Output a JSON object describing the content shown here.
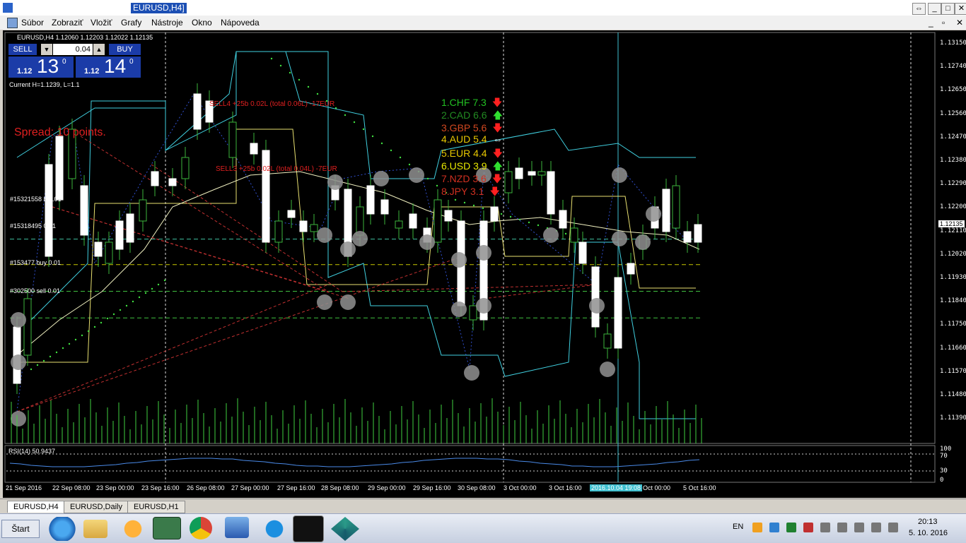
{
  "window": {
    "title": "EURUSD,H4]",
    "buttons": {
      "restore": "⇔",
      "minimize": "_",
      "maximize": "□",
      "close": "✕"
    }
  },
  "menu": [
    "Súbor",
    "Zobraziť",
    "Vložiť",
    "Grafy",
    "Nástroje",
    "Okno",
    "Nápoveda"
  ],
  "chart": {
    "header": "EURUSD,H4  1.12060 1.12203 1.12022 1.12135",
    "oneclick": {
      "sell": "SELL",
      "buy": "BUY",
      "lot": "0.04",
      "sell_small": "1.12",
      "sell_big": "13",
      "sell_sup": "0",
      "buy_small": "1.12",
      "buy_big": "14",
      "buy_sup": "0"
    },
    "current_hl": "Current H=1.1239, L=1.1",
    "spread": "Spread: 10 points.",
    "order_labels": [
      "#15321558 b 0.01",
      "#15318495 0.01",
      "#153477 buy 0.01",
      "#302500 sell 0.01"
    ],
    "trade_notes": [
      "SELL4  +25b  0.02L (total 0.06L)  -17EUR",
      "SELL3  +25b  0.02L (total 0.04L)  -7EUR"
    ],
    "current_price": "1.12135",
    "price_axis": [
      "1.13150",
      "1.12740",
      "1.12650",
      "1.12560",
      "1.12470",
      "1.12380",
      "1.12290",
      "1.12200",
      "1.12110",
      "1.12020",
      "1.11930",
      "1.11840",
      "1.11750",
      "1.11660",
      "1.11570",
      "1.11480",
      "1.11390"
    ],
    "time_axis": [
      "21 Sep 2016",
      "22 Sep 08:00",
      "23 Sep 00:00",
      "23 Sep 16:00",
      "26 Sep 08:00",
      "27 Sep 00:00",
      "27 Sep 16:00",
      "28 Sep 08:00",
      "29 Sep 00:00",
      "29 Sep 16:00",
      "30 Sep 08:00",
      "3 Oct 00:00",
      "3 Oct 16:00",
      "2016.10.04 19:08",
      "Oct 00:00",
      "5 Oct 16:00"
    ],
    "rsi_label": "RSI(14) 50.9437",
    "rsi_axis": [
      "100",
      "70",
      "30",
      "0"
    ]
  },
  "strength": [
    {
      "text": "1.CHF  7.3",
      "color": "#22c022",
      "arrow": "down"
    },
    {
      "text": "2.CAD  6.6",
      "color": "#228b22",
      "arrow": "up"
    },
    {
      "text": "3.GBP  5.6",
      "color": "#d24820",
      "arrow": "down"
    },
    {
      "text": "4.AUD  5.4",
      "color": "#e8c800",
      "arrow": "both"
    },
    {
      "text": "5.EUR  4.4",
      "color": "#e8c800",
      "arrow": "down"
    },
    {
      "text": "6.USD  3.9",
      "color": "#e8e800",
      "arrow": "up"
    },
    {
      "text": "7.NZD  3.6",
      "color": "#d03020",
      "arrow": "down"
    },
    {
      "text": "8.JPY  3.1",
      "color": "#d03020",
      "arrow": "down"
    }
  ],
  "tabs": [
    "EURUSD,H4",
    "EURUSD,Daily",
    "EURUSD,H1"
  ],
  "taskbar": {
    "start": "Štart",
    "lang": "EN",
    "time": "20:13",
    "date": "5. 10. 2016",
    "apps": [
      "ie-icon",
      "folder-icon",
      "media-icon",
      "metatrader-icon",
      "chrome-icon",
      "control-panel-icon",
      "refresh-app-icon",
      "trading-app-icon",
      "cube-app-icon"
    ]
  },
  "colors": {
    "sell": "#1b3ca8",
    "bull_candle": "#3cb43c",
    "bear_candle": "#ffffff",
    "grid": "#ffffff",
    "channel": "#40d0e0",
    "ma": "#f0e68c"
  }
}
